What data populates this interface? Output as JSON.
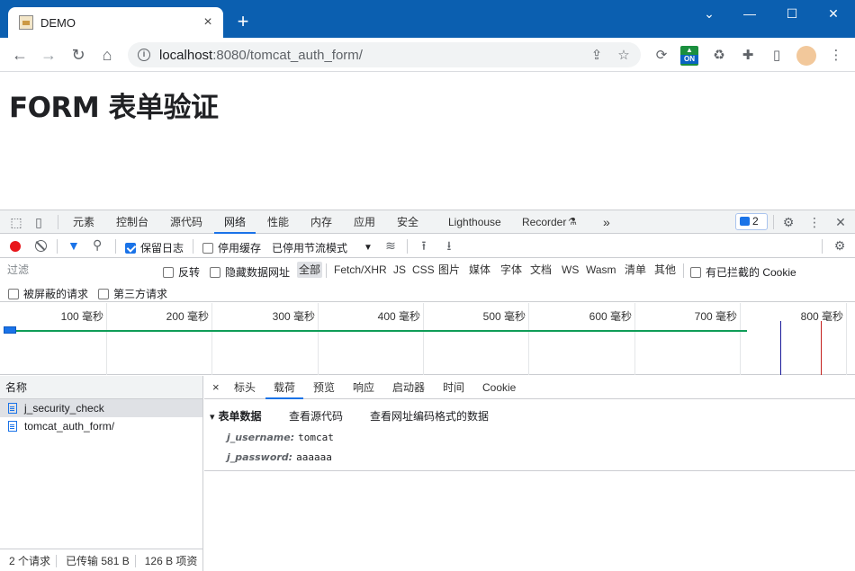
{
  "browser": {
    "tab_title": "DEMO",
    "tab_close": "×",
    "new_tab": "+",
    "url_host": "localhost",
    "url_rest": ":8080/tomcat_auth_form/",
    "win_min": "⌄",
    "win_minimize": "—",
    "win_max": "☐",
    "win_close": "✕",
    "ext_on_label": "ON"
  },
  "page": {
    "heading": "FORM 表单验证"
  },
  "devtools": {
    "tabs": [
      "元素",
      "控制台",
      "源代码",
      "网络",
      "性能",
      "内存",
      "应用",
      "安全",
      "Lighthouse",
      "Recorder"
    ],
    "active_tab": "网络",
    "message_count": "2",
    "toolbar": {
      "preserve_log": "保留日志",
      "preserve_log_checked": true,
      "disable_cache": "停用缓存",
      "disable_cache_checked": false,
      "throttle": "已停用节流模式"
    },
    "filter": {
      "placeholder": "过滤",
      "invert": "反转",
      "hide_data_urls": "隐藏数据网址",
      "types": [
        "全部",
        "Fetch/XHR",
        "JS",
        "CSS",
        "图片",
        "媒体",
        "字体",
        "文档",
        "WS",
        "Wasm",
        "清单",
        "其他"
      ],
      "active_type": "全部",
      "blocked_cookies": "有已拦截的 Cookie",
      "blocked_requests": "被屏蔽的请求",
      "third_party": "第三方请求"
    },
    "timeline": {
      "ticks": [
        "100 毫秒",
        "200 毫秒",
        "300 毫秒",
        "400 毫秒",
        "500 毫秒",
        "600 毫秒",
        "700 毫秒",
        "800 毫秒"
      ]
    },
    "requests": {
      "column_name": "名称",
      "items": [
        "j_security_check",
        "tomcat_auth_form/"
      ],
      "selected": "j_security_check"
    },
    "status": {
      "count": "2 个请求",
      "transferred": "已传输 581 B",
      "resources": "126 B 项资"
    },
    "detail": {
      "close": "×",
      "tabs": [
        "标头",
        "载荷",
        "预览",
        "响应",
        "启动器",
        "时间",
        "Cookie"
      ],
      "active_tab": "载荷",
      "section_title": "表单数据",
      "view_source": "查看源代码",
      "view_url_encoded": "查看网址编码格式的数据",
      "fields": [
        {
          "key": "j_username:",
          "value": "tomcat"
        },
        {
          "key": "j_password:",
          "value": "aaaaaa"
        }
      ]
    }
  },
  "colors": {
    "titlebar": "#0b5fb0",
    "accent": "#1a73e8",
    "record": "#e8161b",
    "timeline_bar": "#0f9d58"
  }
}
